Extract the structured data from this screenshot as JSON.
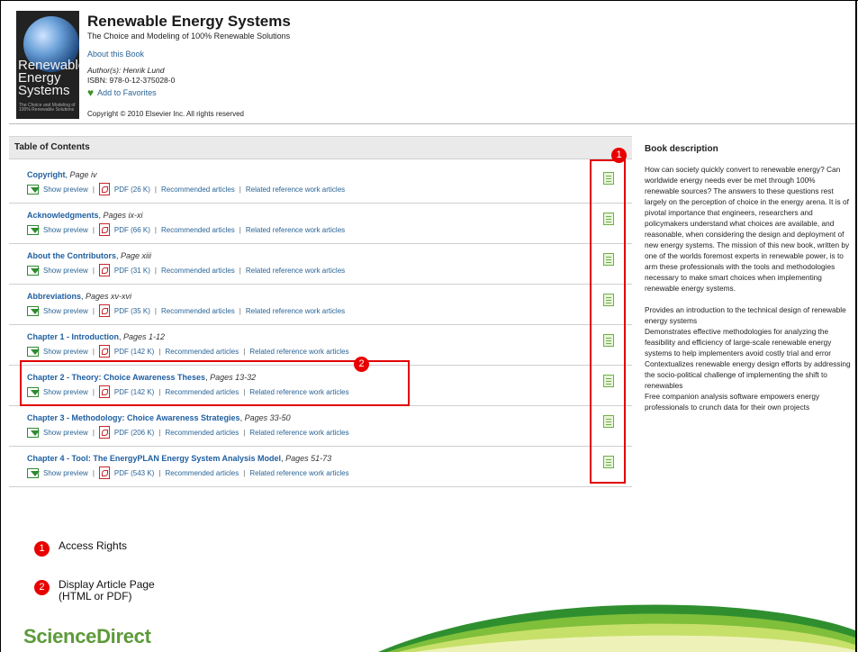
{
  "book": {
    "title": "Renewable Energy Systems",
    "subtitle": "The Choice and Modeling of 100% Renewable Solutions",
    "about_link": "About this Book",
    "authors": "Author(s): Henrik Lund",
    "isbn": "ISBN: 978-0-12-375028-0",
    "favorites": "Add to Favorites",
    "copyright": "Copyright © 2010 Elsevier Inc. All rights reserved",
    "cover_title": "Renewable Energy Systems",
    "cover_subtitle": "The Choice and Modeling of 100% Renewable Solutions"
  },
  "toc": {
    "heading": "Table of Contents",
    "link_labels": {
      "preview": "Show preview",
      "recommended": "Recommended articles",
      "related": "Related reference work articles"
    },
    "items": [
      {
        "title": "Copyright",
        "pages": "Page iv",
        "pdf": "PDF (26 K)"
      },
      {
        "title": "Acknowledgments",
        "pages": "Pages ix-xi",
        "pdf": "PDF (66 K)"
      },
      {
        "title": "About the Contributors",
        "pages": "Page xiii",
        "pdf": "PDF (31 K)"
      },
      {
        "title": "Abbreviations",
        "pages": "Pages xv-xvi",
        "pdf": "PDF (35 K)"
      },
      {
        "title": "Chapter 1 - Introduction",
        "pages": "Pages 1-12",
        "pdf": "PDF (142 K)"
      },
      {
        "title": "Chapter 2 - Theory: Choice Awareness Theses",
        "pages": "Pages 13-32",
        "pdf": "PDF (142 K)"
      },
      {
        "title": "Chapter 3 - Methodology: Choice Awareness Strategies",
        "pages": "Pages 33-50",
        "pdf": "PDF (206 K)"
      },
      {
        "title": "Chapter 4 - Tool: The EnergyPLAN Energy System Analysis Model",
        "pages": "Pages 51-73",
        "pdf": "PDF (543 K)"
      }
    ]
  },
  "description": {
    "heading": "Book description",
    "paragraph": "How can society quickly convert to renewable energy? Can worldwide energy needs ever be met through 100% renewable sources? The answers to these questions rest largely on the perception of choice in the energy arena. It is of pivotal importance that engineers, researchers and policymakers understand what choices are available, and reasonable, when considering the design and deployment of new energy systems. The mission of this new book, written by one of the worlds foremost experts in renewable power, is to arm these professionals with the tools and methodologies necessary to make smart choices when implementing renewable energy systems.",
    "bullets": [
      "Provides an introduction to the technical design of renewable energy systems",
      "Demonstrates effective methodologies for analyzing the feasibility and efficiency of large-scale renewable energy systems to help implementers avoid costly trial and error",
      "Contextualizes renewable energy design efforts by addressing the socio-political challenge of implementing the shift to renewables",
      "Free companion analysis software empowers energy professionals to crunch data for their own projects"
    ]
  },
  "callouts": {
    "badge1": "1",
    "badge2": "2",
    "legend": [
      {
        "num": "1",
        "text": "Access Rights"
      },
      {
        "num": "2",
        "text": "Display Article Page (HTML or PDF)"
      }
    ]
  },
  "brand": "ScienceDirect",
  "colors": {
    "accent_red": "#e80000",
    "brand_green": "#5c9a3a",
    "link_blue": "#2a6496"
  }
}
